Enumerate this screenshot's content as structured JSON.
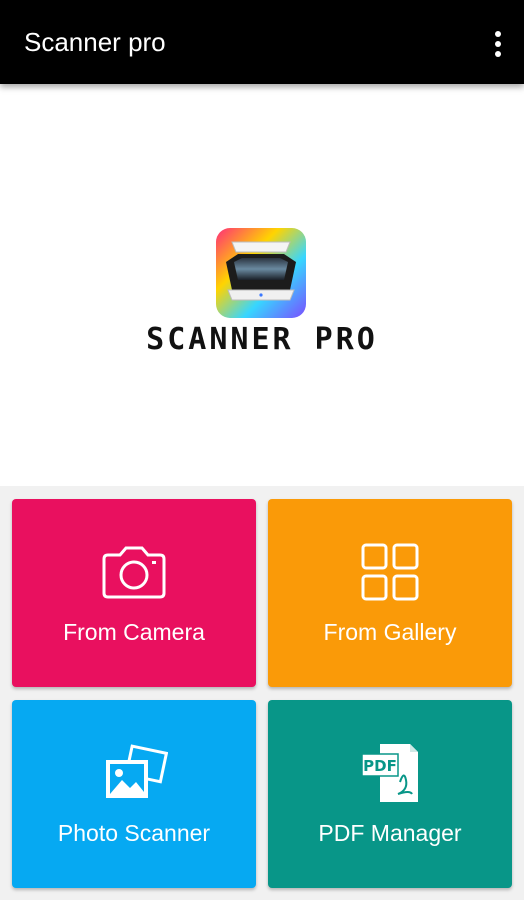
{
  "toolbar": {
    "title": "Scanner pro",
    "menu_icon": "more-vert-icon"
  },
  "hero": {
    "logo_icon": "scanner-logo-icon",
    "logo_text": "SCANNER PRO"
  },
  "tiles": [
    {
      "label": "From Camera",
      "icon": "camera-icon",
      "color": "#e9105f"
    },
    {
      "label": "From Gallery",
      "icon": "grid-icon",
      "color": "#fa9a08"
    },
    {
      "label": "Photo Scanner",
      "icon": "photos-icon",
      "color": "#06a9f2"
    },
    {
      "label": "PDF Manager",
      "icon": "pdf-icon",
      "color": "#089688"
    }
  ],
  "pdf_icon_text": "PDF",
  "colors": {
    "toolbar": "#000000",
    "grid_background": "#f1f1f1"
  }
}
